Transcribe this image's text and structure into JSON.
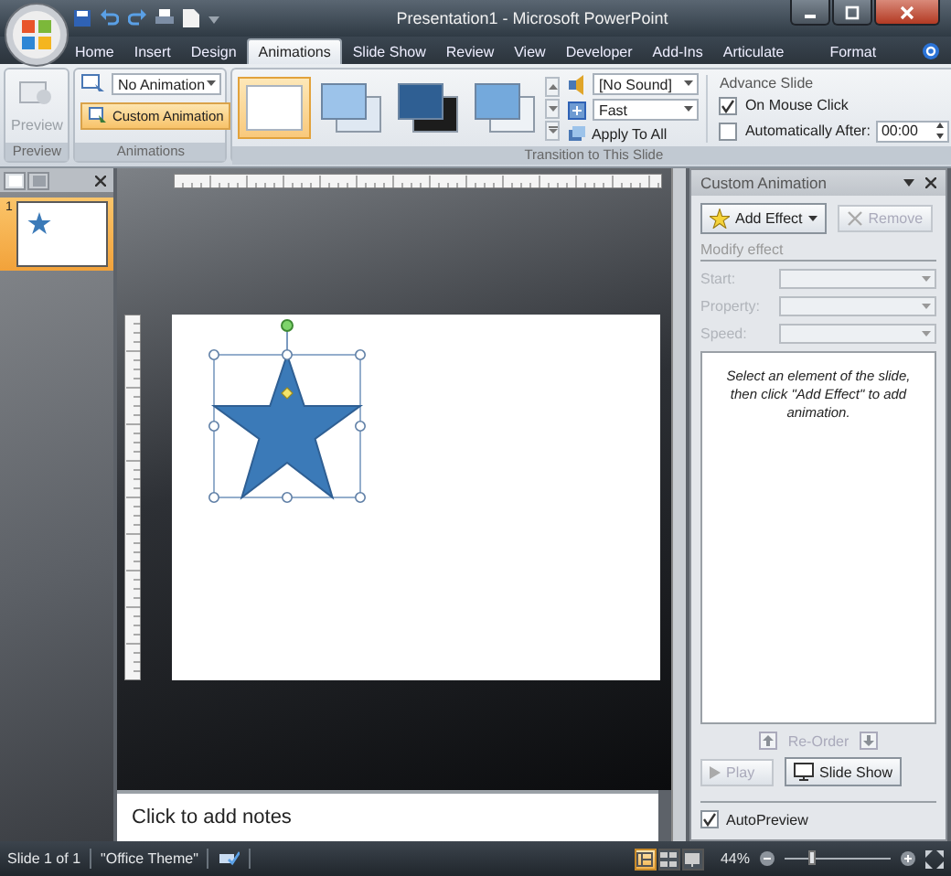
{
  "window": {
    "title": "Presentation1 - Microsoft PowerPoint"
  },
  "ribbon_tabs": [
    {
      "label": "Home",
      "selected": false
    },
    {
      "label": "Insert",
      "selected": false
    },
    {
      "label": "Design",
      "selected": false
    },
    {
      "label": "Animations",
      "selected": true
    },
    {
      "label": "Slide Show",
      "selected": false
    },
    {
      "label": "Review",
      "selected": false
    },
    {
      "label": "View",
      "selected": false
    },
    {
      "label": "Developer",
      "selected": false
    },
    {
      "label": "Add-Ins",
      "selected": false
    },
    {
      "label": "Articulate",
      "selected": false
    },
    {
      "label": "Format",
      "selected": false
    }
  ],
  "preview_group": {
    "button": {
      "label": "Preview",
      "disabled": true
    },
    "label": "Preview"
  },
  "animations_group": {
    "animation_dropdown": "No Animation",
    "custom_animation_button": "Custom Animation",
    "label": "Animations"
  },
  "transition_group": {
    "label": "Transition to This Slide",
    "transitions": [
      {
        "kind": "none",
        "selected": true
      },
      {
        "kind": "light",
        "selected": false
      },
      {
        "kind": "dark",
        "selected": false
      },
      {
        "kind": "blue",
        "selected": false
      }
    ],
    "sound": "[No Sound]",
    "speed": "Fast",
    "apply_all": "Apply To All",
    "advance_slide": {
      "title": "Advance Slide",
      "on_mouse_click": {
        "label": "On Mouse Click",
        "checked": true
      },
      "automatically_after": {
        "label": "Automatically After:",
        "checked": false,
        "value": "00:00"
      }
    }
  },
  "slides_pane": {
    "thumbnails": [
      {
        "number": "1",
        "selected": true
      }
    ]
  },
  "notes": {
    "prompt": "Click to add notes"
  },
  "task_pane": {
    "title": "Custom Animation",
    "add_effect": "Add Effect",
    "remove": {
      "label": "Remove",
      "disabled": true
    },
    "section": "Modify effect",
    "fields": [
      {
        "label": "Start:",
        "disabled": true
      },
      {
        "label": "Property:",
        "disabled": true
      },
      {
        "label": "Speed:",
        "disabled": true
      }
    ],
    "hint": "Select an element of the slide, then click \"Add Effect\" to add animation.",
    "reorder": {
      "label": "Re-Order",
      "disabled": true
    },
    "play": {
      "label": "Play",
      "disabled": true
    },
    "slide_show": "Slide Show",
    "autopreview": {
      "label": "AutoPreview",
      "checked": true
    }
  },
  "status_bar": {
    "slide": "Slide 1 of 1",
    "theme": "\"Office Theme\"",
    "views": [
      {
        "kind": "normal",
        "selected": true
      },
      {
        "kind": "sorter",
        "selected": false
      },
      {
        "kind": "show",
        "selected": false
      }
    ],
    "zoom": "44%",
    "zoom_slider": {
      "level": 0.25
    }
  }
}
